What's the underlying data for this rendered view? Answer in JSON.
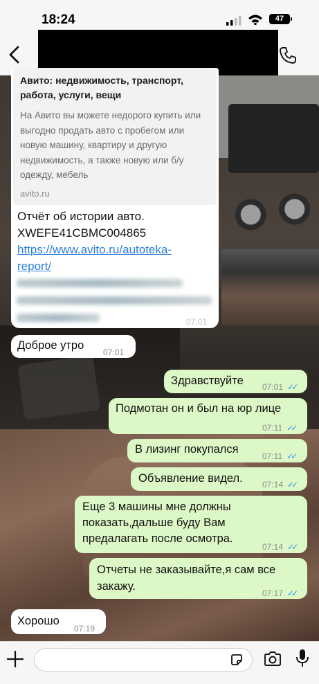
{
  "status": {
    "time": "18:24",
    "battery": "47"
  },
  "link_preview": {
    "title": "Авито: недвижимость, транспорт, работа, услуги, вещи",
    "description": "На Авито вы можете недорого купить или выгодно продать авто с пробегом или новую машину, квартиру и другую недвижимость, а также новую или б/у одежду, мебель",
    "domain": "avito.ru"
  },
  "first_message": {
    "line1": "Отчёт об истории авто.",
    "line2": "XWEFE41CBMC004865",
    "link1": "https://www.avito.ru/autoteka-",
    "link2": "report/",
    "time": "07:01"
  },
  "messages": [
    {
      "text": "Доброе утро",
      "time": "07:01",
      "dir": "in"
    },
    {
      "text": "Здравствуйте",
      "time": "07:01",
      "dir": "out"
    },
    {
      "text": "Подмотан он и был на юр лице",
      "time": "07:11",
      "dir": "out"
    },
    {
      "text": "В лизинг покупался",
      "time": "07:11",
      "dir": "out"
    },
    {
      "text": "Объявление видел.",
      "time": "07:14",
      "dir": "out"
    },
    {
      "text": "Еще 3 машины мне должны показать,дальше буду Вам предалагать после осмотра.",
      "time": "07:14",
      "dir": "out"
    },
    {
      "text": "Отчеты не заказывайте,я сам все закажу.",
      "time": "07:17",
      "dir": "out"
    },
    {
      "text": "Хорошо",
      "time": "07:19",
      "dir": "in"
    }
  ],
  "icons": {
    "back": "chevron-left-icon",
    "call": "phone-icon",
    "attach": "plus-icon",
    "sticker": "sticker-icon",
    "camera": "camera-icon",
    "mic": "microphone-icon"
  },
  "colors": {
    "incoming": "#ffffff",
    "outgoing": "#dcf8c6",
    "link": "#2a7fd8",
    "read_ticks": "#3497f9"
  }
}
